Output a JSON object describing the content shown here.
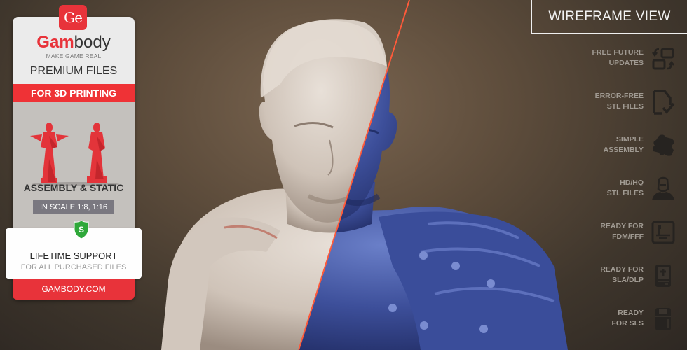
{
  "badge": {
    "logo_text": "Ge",
    "brand_red": "Gam",
    "brand_dark": "body",
    "tagline": "MAKE GAME REAL",
    "premium": "PREMIUM FILES",
    "for_printing": "FOR 3D PRINTING",
    "assembly": "ASSEMBLY & STATIC",
    "scale": "IN SCALE 1:8, 1:16",
    "shield_letter": "S",
    "lifetime": "LIFETIME SUPPORT",
    "purchased": "FOR ALL PURCHASED FILES",
    "site": "GAMBODY.COM"
  },
  "wireframe_button": "WIREFRAME VIEW",
  "features": [
    {
      "line1": "FREE FUTURE",
      "line2": "UPDATES",
      "icon": "update-arrows-icon"
    },
    {
      "line1": "ERROR-FREE",
      "line2": "STL FILES",
      "icon": "file-check-icon"
    },
    {
      "line1": "SIMPLE",
      "line2": "ASSEMBLY",
      "icon": "puzzle-icon"
    },
    {
      "line1": "HD/HQ",
      "line2": "STL FILES",
      "icon": "bust-icon"
    },
    {
      "line1": "READY FOR",
      "line2": "FDM/FFF",
      "icon": "fdm-printer-icon"
    },
    {
      "line1": "READY FOR",
      "line2": "SLA/DLP",
      "icon": "sla-printer-icon"
    },
    {
      "line1": "READY",
      "line2": "FOR SLS",
      "icon": "sls-printer-icon"
    }
  ],
  "colors": {
    "brand_red": "#e8333a",
    "split_line": "#ff5a3a",
    "wire_blue": "#3a4f9c",
    "clay": "#d9d0c8"
  }
}
